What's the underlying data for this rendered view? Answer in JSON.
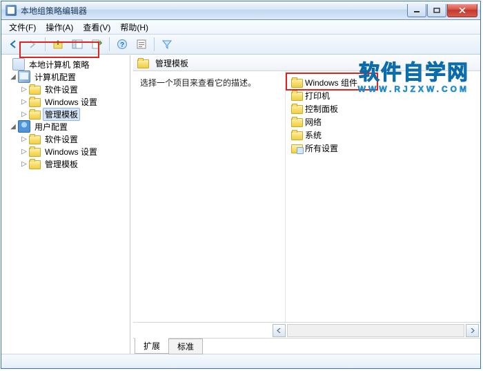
{
  "window": {
    "title": "本地组策略编辑器"
  },
  "menu": {
    "file": "文件(F)",
    "action": "操作(A)",
    "view": "查看(V)",
    "help": "帮助(H)"
  },
  "toolbar": {
    "back": "后退",
    "forward": "前进",
    "up": "上移",
    "tree_toggle": "显示/隐藏控制台树",
    "export": "导出列表",
    "help": "帮助",
    "properties": "属性",
    "filter": "筛选"
  },
  "tree": {
    "root": "本地计算机 策略",
    "computer_cfg": "计算机配置",
    "user_cfg": "用户配置",
    "software_settings": "软件设置",
    "windows_settings": "Windows 设置",
    "admin_templates": "管理模板"
  },
  "header": {
    "title": "管理模板"
  },
  "description": "选择一个项目来查看它的描述。",
  "list": {
    "windows_components": "Windows 组件",
    "printers": "打印机",
    "control_panel": "控制面板",
    "network": "网络",
    "system": "系统",
    "all_settings": "所有设置"
  },
  "tabs": {
    "extended": "扩展",
    "standard": "标准"
  },
  "watermark": {
    "line1": "软件自学网",
    "line2": "WWW.RJZXW.COM"
  }
}
